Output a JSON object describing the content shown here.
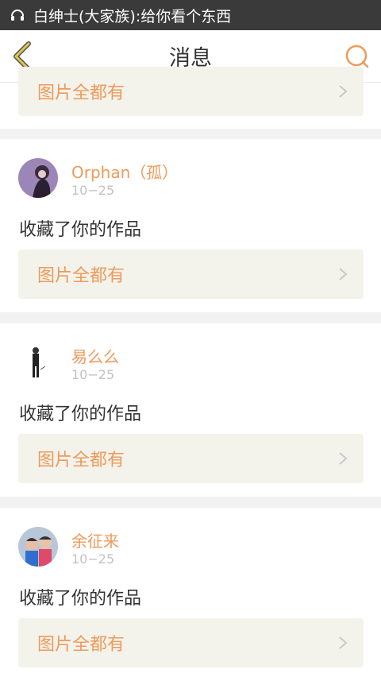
{
  "status_bar": {
    "notification_text": "白绅士(大家族):给你看个东西"
  },
  "nav": {
    "title": "消息"
  },
  "top_card": {
    "work_title": "图片全都有"
  },
  "messages": [
    {
      "username": "Orphan（孤）",
      "date": "10−25",
      "action": "收藏了你的作品",
      "work_title": "图片全都有"
    },
    {
      "username": "易么么",
      "date": "10−25",
      "action": "收藏了你的作品",
      "work_title": "图片全都有"
    },
    {
      "username": "余征来",
      "date": "10−25",
      "action": "收藏了你的作品",
      "work_title": "图片全都有"
    }
  ],
  "colors": {
    "accent_orange": "#ef9a5a",
    "back_arrow_yellow": "#e0c64a",
    "status_bar_bg": "#3a3a3a"
  }
}
